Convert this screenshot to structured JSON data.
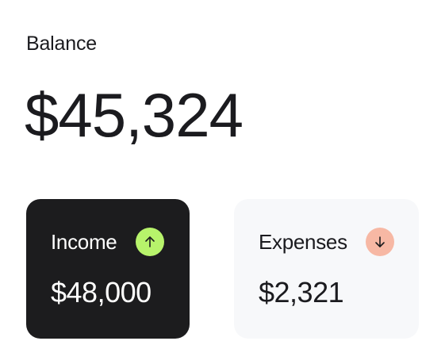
{
  "balance": {
    "label": "Balance",
    "amount": "$45,324"
  },
  "cards": {
    "income": {
      "title": "Income",
      "value": "$48,000",
      "icon": "arrow-up-icon",
      "icon_color": "#b7f36b",
      "background": "#1c1c1e"
    },
    "expenses": {
      "title": "Expenses",
      "value": "$2,321",
      "icon": "arrow-down-icon",
      "icon_color": "#f7b8a4",
      "background": "#f7f8fa"
    }
  }
}
